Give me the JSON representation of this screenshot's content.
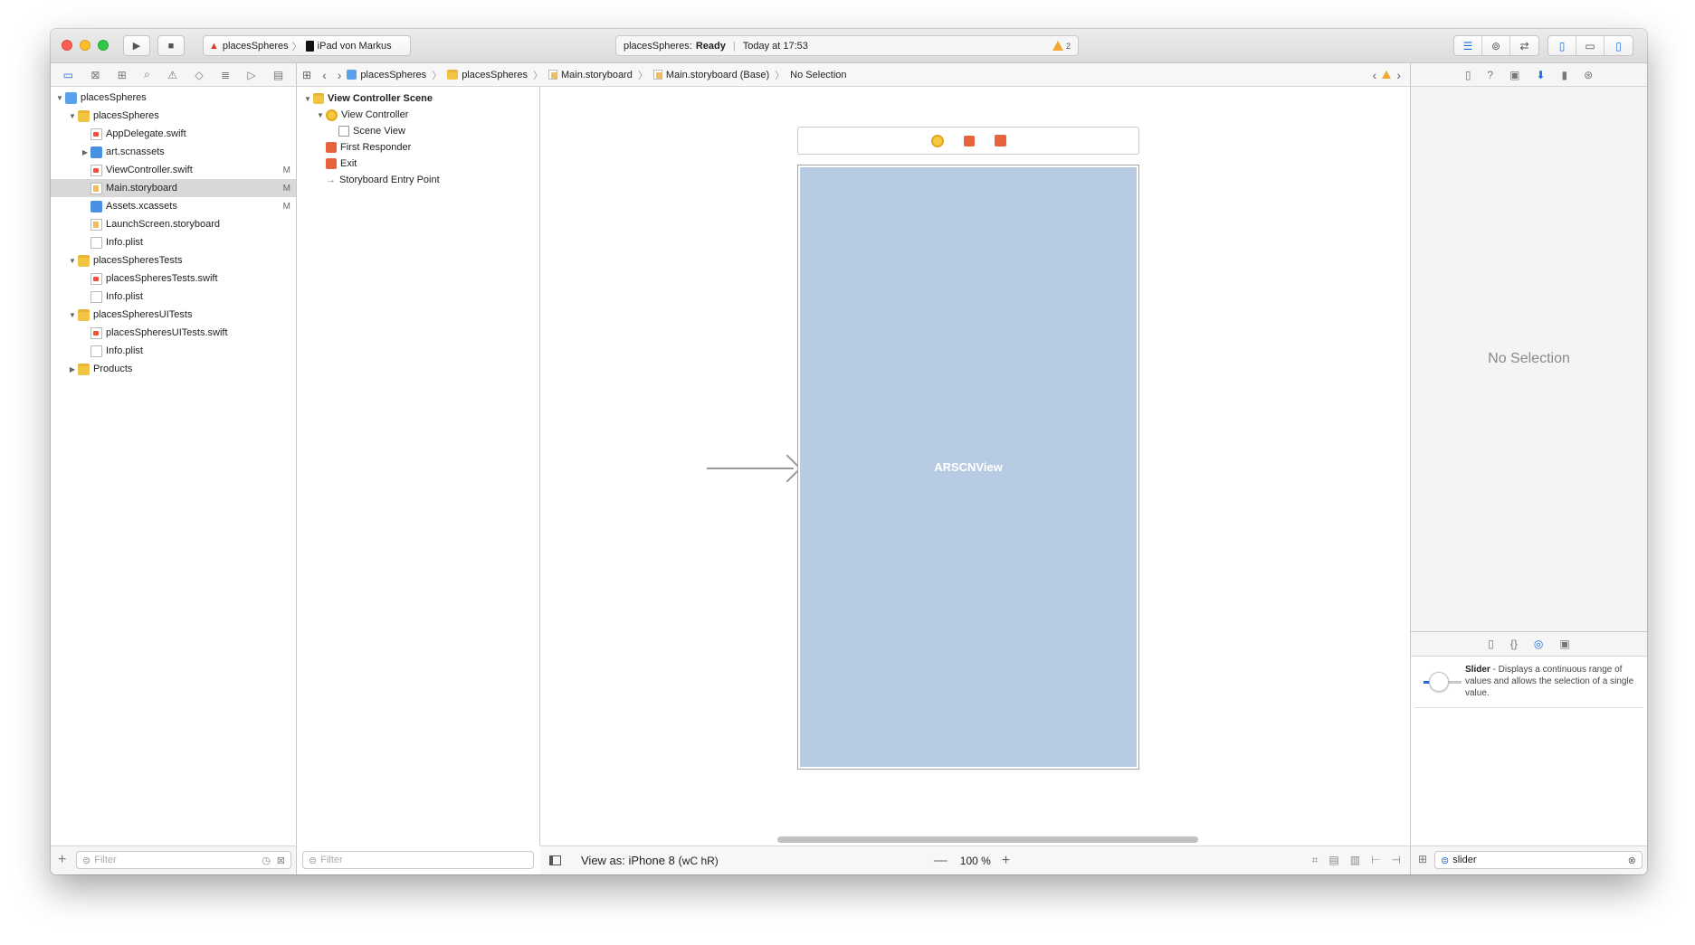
{
  "toolbar": {
    "scheme": "placesSpheres",
    "device": "iPad von Markus",
    "status_app": "placesSpheres:",
    "status_state": "Ready",
    "status_time": "Today at 17:53",
    "warnings": "2"
  },
  "navigator": {
    "items": [
      {
        "label": "placesSpheres",
        "badge": ""
      },
      {
        "label": "placesSpheres",
        "badge": ""
      },
      {
        "label": "AppDelegate.swift",
        "badge": ""
      },
      {
        "label": "art.scnassets",
        "badge": ""
      },
      {
        "label": "ViewController.swift",
        "badge": "M"
      },
      {
        "label": "Main.storyboard",
        "badge": "M"
      },
      {
        "label": "Assets.xcassets",
        "badge": "M"
      },
      {
        "label": "LaunchScreen.storyboard",
        "badge": ""
      },
      {
        "label": "Info.plist",
        "badge": ""
      },
      {
        "label": "placesSpheresTests",
        "badge": ""
      },
      {
        "label": "placesSpheresTests.swift",
        "badge": ""
      },
      {
        "label": "Info.plist",
        "badge": ""
      },
      {
        "label": "placesSpheresUITests",
        "badge": ""
      },
      {
        "label": "placesSpheresUITests.swift",
        "badge": ""
      },
      {
        "label": "Info.plist",
        "badge": ""
      },
      {
        "label": "Products",
        "badge": ""
      }
    ],
    "filter_placeholder": "Filter"
  },
  "jumpbar": {
    "crumbs": [
      "placesSpheres",
      "placesSpheres",
      "Main.storyboard",
      "Main.storyboard (Base)",
      "No Selection"
    ]
  },
  "outline": {
    "items": [
      "View Controller Scene",
      "View Controller",
      "Scene View",
      "First Responder",
      "Exit",
      "Storyboard Entry Point"
    ],
    "filter_placeholder": "Filter"
  },
  "canvas": {
    "view_label": "ARSCNView",
    "view_as": "View as: iPhone 8 (",
    "size_class": "wC hR)",
    "zoom": "100 %"
  },
  "inspector": {
    "empty": "No Selection"
  },
  "library": {
    "item_title": "Slider",
    "item_desc": " - Displays a continuous range of values and allows the selection of a single value.",
    "search_value": "slider"
  }
}
